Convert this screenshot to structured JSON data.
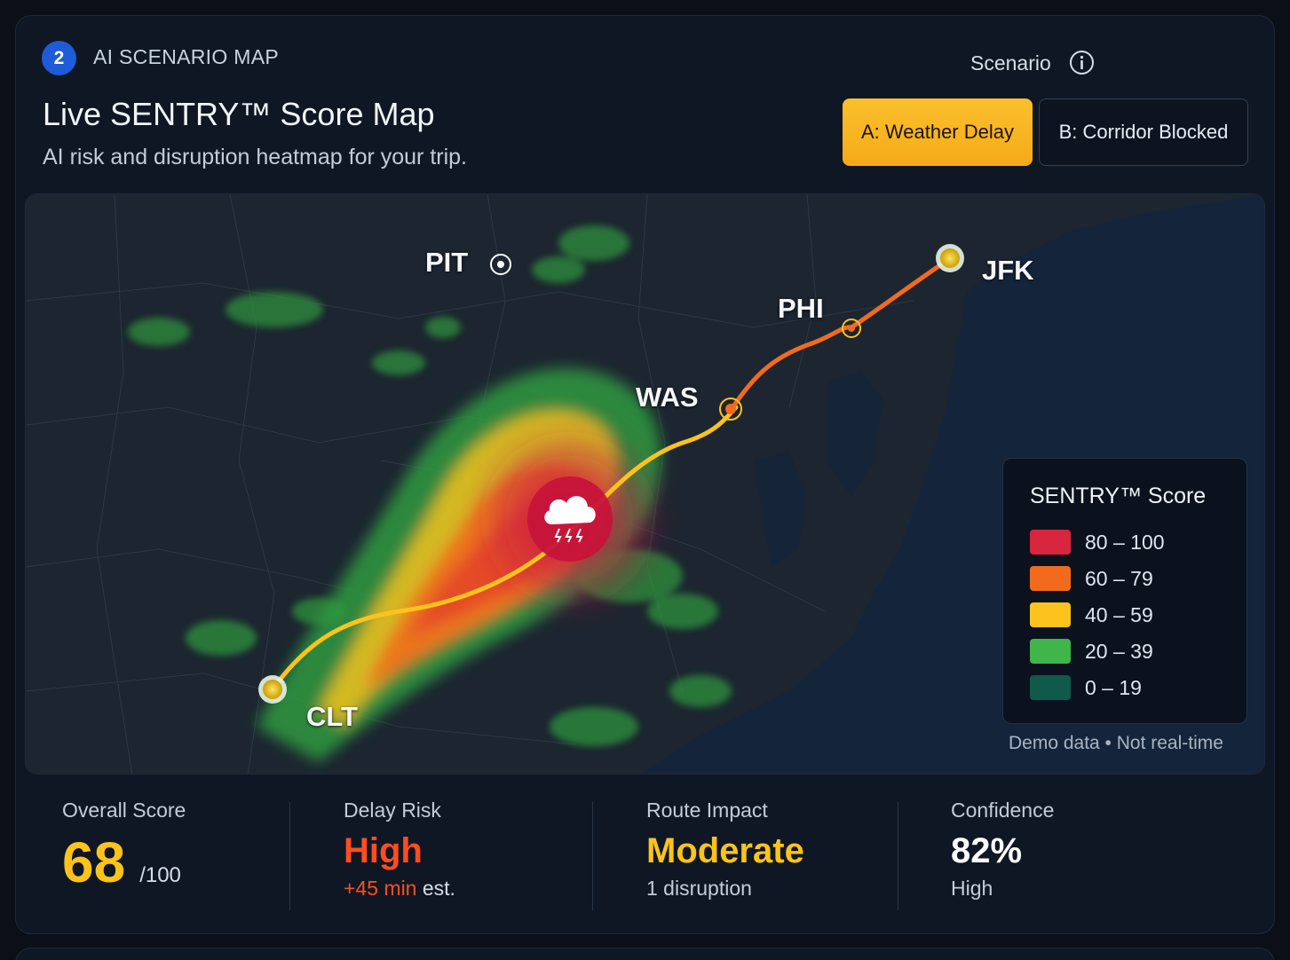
{
  "header": {
    "step_number": "2",
    "section_label": "AI SCENARIO MAP",
    "title": "Live SENTRY™ Score Map",
    "subtitle": "AI risk and disruption heatmap for your trip."
  },
  "scenario": {
    "label": "Scenario",
    "options": [
      {
        "label": "A: Weather Delay",
        "selected": true
      },
      {
        "label": "B: Corridor Blocked",
        "selected": false
      }
    ]
  },
  "map": {
    "cities": {
      "pit": "PIT",
      "jfk": "JFK",
      "phi": "PHI",
      "was": "WAS",
      "clt": "CLT"
    },
    "legend": {
      "title": "SENTRY™ Score",
      "items": [
        {
          "range": "80 – 100",
          "color": "#d7263d"
        },
        {
          "range": "60 – 79",
          "color": "#f26b1d"
        },
        {
          "range": "40 – 59",
          "color": "#fbc31b"
        },
        {
          "range": "20 – 39",
          "color": "#3fb54a"
        },
        {
          "range": "0 – 19",
          "color": "#0f5a4a"
        }
      ]
    },
    "note": "Demo data • Not real-time",
    "storm_icon": "storm-cloud-icon"
  },
  "stats": {
    "overall": {
      "label": "Overall Score",
      "value": "68",
      "suffix": "/100",
      "color": "#fbc31b"
    },
    "delay": {
      "label": "Delay Risk",
      "value": "High",
      "extra_highlight": "+45 min",
      "extra_rest": " est.",
      "color": "#ff4d1f"
    },
    "route": {
      "label": "Route Impact",
      "value": "Moderate",
      "detail": "1 disruption",
      "color": "#fbc31b"
    },
    "confidence": {
      "label": "Confidence",
      "value": "82%",
      "detail": "High",
      "color": "#ffffff"
    }
  }
}
